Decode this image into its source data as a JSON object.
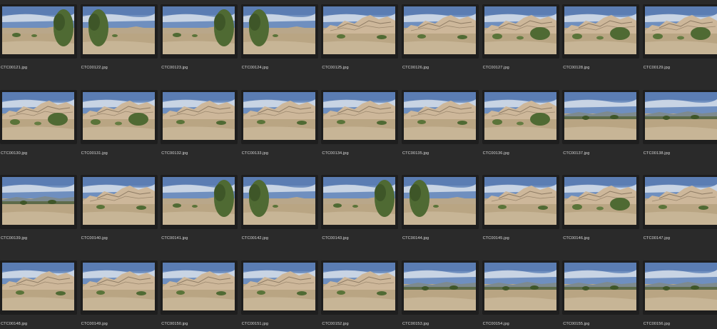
{
  "browser": {
    "thumbnails": [
      {
        "filename": "CTC00121.jpg",
        "scene": "tree-left"
      },
      {
        "filename": "CTC00122.jpg",
        "scene": "tree-left"
      },
      {
        "filename": "CTC00123.jpg",
        "scene": "tree-left"
      },
      {
        "filename": "CTC00124.jpg",
        "scene": "tree-left"
      },
      {
        "filename": "CTC00125.jpg",
        "scene": "rocks"
      },
      {
        "filename": "CTC00126.jpg",
        "scene": "rocks"
      },
      {
        "filename": "CTC00127.jpg",
        "scene": "rocks-bush"
      },
      {
        "filename": "CTC00128.jpg",
        "scene": "rocks-bush"
      },
      {
        "filename": "CTC00129.jpg",
        "scene": "rocks-bush"
      },
      {
        "filename": "CTC00130.jpg",
        "scene": "rocks-bush"
      },
      {
        "filename": "CTC00131.jpg",
        "scene": "rocks-bush"
      },
      {
        "filename": "CTC00132.jpg",
        "scene": "rocks"
      },
      {
        "filename": "CTC00133.jpg",
        "scene": "rocks"
      },
      {
        "filename": "CTC00134.jpg",
        "scene": "rocks"
      },
      {
        "filename": "CTC00135.jpg",
        "scene": "rocks"
      },
      {
        "filename": "CTC00136.jpg",
        "scene": "rocks-bush"
      },
      {
        "filename": "CTC00137.jpg",
        "scene": "flat"
      },
      {
        "filename": "CTC00138.jpg",
        "scene": "flat"
      },
      {
        "filename": "CTC00139.jpg",
        "scene": "flat"
      },
      {
        "filename": "CTC00140.jpg",
        "scene": "rocks"
      },
      {
        "filename": "CTC00141.jpg",
        "scene": "tree-left"
      },
      {
        "filename": "CTC00142.jpg",
        "scene": "tree-left"
      },
      {
        "filename": "CTC00143.jpg",
        "scene": "tree-left"
      },
      {
        "filename": "CTC00144.jpg",
        "scene": "tree-left"
      },
      {
        "filename": "CTC00145.jpg",
        "scene": "rocks"
      },
      {
        "filename": "CTC00146.jpg",
        "scene": "rocks-bush"
      },
      {
        "filename": "CTC00147.jpg",
        "scene": "rocks"
      },
      {
        "filename": "CTC00148.jpg",
        "scene": "rocks"
      },
      {
        "filename": "CTC00149.jpg",
        "scene": "rocks"
      },
      {
        "filename": "CTC00150.jpg",
        "scene": "rocks"
      },
      {
        "filename": "CTC00151.jpg",
        "scene": "rocks"
      },
      {
        "filename": "CTC00152.jpg",
        "scene": "rocks"
      },
      {
        "filename": "CTC00153.jpg",
        "scene": "flat"
      },
      {
        "filename": "CTC00154.jpg",
        "scene": "flat"
      },
      {
        "filename": "CTC00155.jpg",
        "scene": "flat"
      },
      {
        "filename": "CTC00156.jpg",
        "scene": "flat"
      }
    ]
  },
  "colors": {
    "background": "#2a2a2a",
    "frame": "#1e1e1e",
    "filename_text": "#d9d9d9",
    "sky": "#6f8fbf",
    "rock": "#cdb79a",
    "ground": "#b9a583",
    "vegetation": "#4f6a33"
  }
}
